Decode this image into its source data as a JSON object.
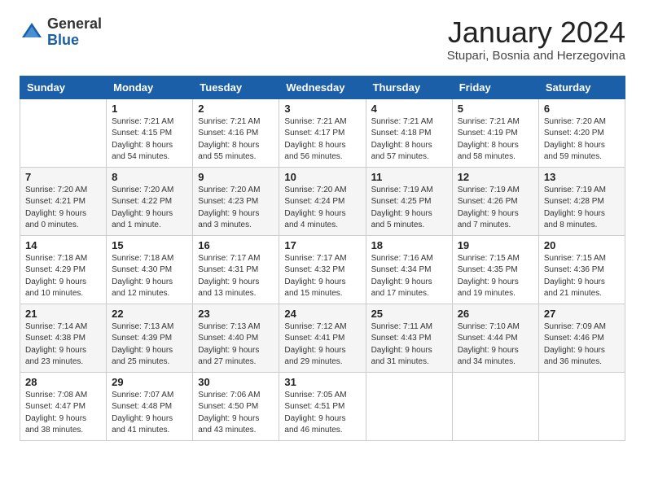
{
  "header": {
    "logo_general": "General",
    "logo_blue": "Blue",
    "month_title": "January 2024",
    "subtitle": "Stupari, Bosnia and Herzegovina"
  },
  "days_of_week": [
    "Sunday",
    "Monday",
    "Tuesday",
    "Wednesday",
    "Thursday",
    "Friday",
    "Saturday"
  ],
  "weeks": [
    [
      {
        "day": "",
        "info": ""
      },
      {
        "day": "1",
        "info": "Sunrise: 7:21 AM\nSunset: 4:15 PM\nDaylight: 8 hours\nand 54 minutes."
      },
      {
        "day": "2",
        "info": "Sunrise: 7:21 AM\nSunset: 4:16 PM\nDaylight: 8 hours\nand 55 minutes."
      },
      {
        "day": "3",
        "info": "Sunrise: 7:21 AM\nSunset: 4:17 PM\nDaylight: 8 hours\nand 56 minutes."
      },
      {
        "day": "4",
        "info": "Sunrise: 7:21 AM\nSunset: 4:18 PM\nDaylight: 8 hours\nand 57 minutes."
      },
      {
        "day": "5",
        "info": "Sunrise: 7:21 AM\nSunset: 4:19 PM\nDaylight: 8 hours\nand 58 minutes."
      },
      {
        "day": "6",
        "info": "Sunrise: 7:20 AM\nSunset: 4:20 PM\nDaylight: 8 hours\nand 59 minutes."
      }
    ],
    [
      {
        "day": "7",
        "info": "Sunrise: 7:20 AM\nSunset: 4:21 PM\nDaylight: 9 hours\nand 0 minutes."
      },
      {
        "day": "8",
        "info": "Sunrise: 7:20 AM\nSunset: 4:22 PM\nDaylight: 9 hours\nand 1 minute."
      },
      {
        "day": "9",
        "info": "Sunrise: 7:20 AM\nSunset: 4:23 PM\nDaylight: 9 hours\nand 3 minutes."
      },
      {
        "day": "10",
        "info": "Sunrise: 7:20 AM\nSunset: 4:24 PM\nDaylight: 9 hours\nand 4 minutes."
      },
      {
        "day": "11",
        "info": "Sunrise: 7:19 AM\nSunset: 4:25 PM\nDaylight: 9 hours\nand 5 minutes."
      },
      {
        "day": "12",
        "info": "Sunrise: 7:19 AM\nSunset: 4:26 PM\nDaylight: 9 hours\nand 7 minutes."
      },
      {
        "day": "13",
        "info": "Sunrise: 7:19 AM\nSunset: 4:28 PM\nDaylight: 9 hours\nand 8 minutes."
      }
    ],
    [
      {
        "day": "14",
        "info": "Sunrise: 7:18 AM\nSunset: 4:29 PM\nDaylight: 9 hours\nand 10 minutes."
      },
      {
        "day": "15",
        "info": "Sunrise: 7:18 AM\nSunset: 4:30 PM\nDaylight: 9 hours\nand 12 minutes."
      },
      {
        "day": "16",
        "info": "Sunrise: 7:17 AM\nSunset: 4:31 PM\nDaylight: 9 hours\nand 13 minutes."
      },
      {
        "day": "17",
        "info": "Sunrise: 7:17 AM\nSunset: 4:32 PM\nDaylight: 9 hours\nand 15 minutes."
      },
      {
        "day": "18",
        "info": "Sunrise: 7:16 AM\nSunset: 4:34 PM\nDaylight: 9 hours\nand 17 minutes."
      },
      {
        "day": "19",
        "info": "Sunrise: 7:15 AM\nSunset: 4:35 PM\nDaylight: 9 hours\nand 19 minutes."
      },
      {
        "day": "20",
        "info": "Sunrise: 7:15 AM\nSunset: 4:36 PM\nDaylight: 9 hours\nand 21 minutes."
      }
    ],
    [
      {
        "day": "21",
        "info": "Sunrise: 7:14 AM\nSunset: 4:38 PM\nDaylight: 9 hours\nand 23 minutes."
      },
      {
        "day": "22",
        "info": "Sunrise: 7:13 AM\nSunset: 4:39 PM\nDaylight: 9 hours\nand 25 minutes."
      },
      {
        "day": "23",
        "info": "Sunrise: 7:13 AM\nSunset: 4:40 PM\nDaylight: 9 hours\nand 27 minutes."
      },
      {
        "day": "24",
        "info": "Sunrise: 7:12 AM\nSunset: 4:41 PM\nDaylight: 9 hours\nand 29 minutes."
      },
      {
        "day": "25",
        "info": "Sunrise: 7:11 AM\nSunset: 4:43 PM\nDaylight: 9 hours\nand 31 minutes."
      },
      {
        "day": "26",
        "info": "Sunrise: 7:10 AM\nSunset: 4:44 PM\nDaylight: 9 hours\nand 34 minutes."
      },
      {
        "day": "27",
        "info": "Sunrise: 7:09 AM\nSunset: 4:46 PM\nDaylight: 9 hours\nand 36 minutes."
      }
    ],
    [
      {
        "day": "28",
        "info": "Sunrise: 7:08 AM\nSunset: 4:47 PM\nDaylight: 9 hours\nand 38 minutes."
      },
      {
        "day": "29",
        "info": "Sunrise: 7:07 AM\nSunset: 4:48 PM\nDaylight: 9 hours\nand 41 minutes."
      },
      {
        "day": "30",
        "info": "Sunrise: 7:06 AM\nSunset: 4:50 PM\nDaylight: 9 hours\nand 43 minutes."
      },
      {
        "day": "31",
        "info": "Sunrise: 7:05 AM\nSunset: 4:51 PM\nDaylight: 9 hours\nand 46 minutes."
      },
      {
        "day": "",
        "info": ""
      },
      {
        "day": "",
        "info": ""
      },
      {
        "day": "",
        "info": ""
      }
    ]
  ]
}
